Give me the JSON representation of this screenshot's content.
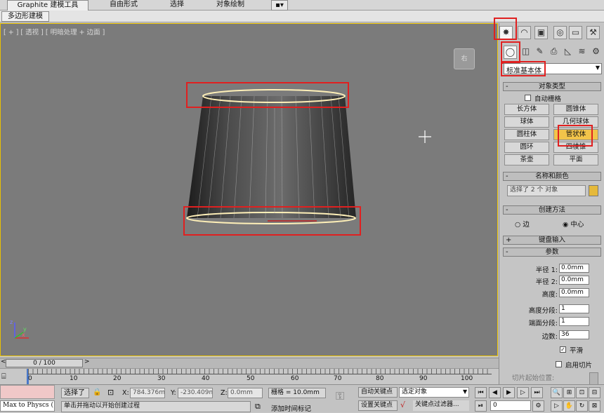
{
  "ribbon": {
    "tabs": [
      "Graphite 建模工具",
      "自由形式",
      "选择",
      "对象绘制",
      "▪▾"
    ],
    "subtab": "多边形建模"
  },
  "viewport": {
    "label": "[ + ] [ 透视 ] [ 明暗处理 + 边面 ]",
    "viewcube_label": "右",
    "axis_labels": [
      "z",
      "x",
      "y"
    ]
  },
  "panel": {
    "tab_icons": [
      "create-icon",
      "modify-icon",
      "hierarchy-icon",
      "motion-icon",
      "display-icon",
      "utilities-icon"
    ],
    "category_icons": [
      "geometry-icon",
      "shapes-icon",
      "lights-icon",
      "cameras-icon",
      "helpers-icon",
      "spacewarps-icon",
      "systems-icon"
    ],
    "dropdown": "标准基本体",
    "object_type": {
      "title": "对象类型",
      "autogrid": "自动栅格",
      "buttons": [
        "长方体",
        "圆锥体",
        "球体",
        "几何球体",
        "圆柱体",
        "管状体",
        "圆环",
        "四棱锥",
        "茶壶",
        "平面"
      ],
      "active": "管状体"
    },
    "name_color": {
      "title": "名称和颜色",
      "name_value": "选择了 2 个 对象",
      "swatch": "#e5b93a"
    },
    "creation_method": {
      "title": "创建方法",
      "options": [
        "边",
        "中心"
      ],
      "selected": "中心"
    },
    "keyboard_title": "键盘输入",
    "params": {
      "title": "参数",
      "radius1_label": "半径 1:",
      "radius1": "0.0mm",
      "radius2_label": "半径 2:",
      "radius2": "0.0mm",
      "height_label": "高度:",
      "height": "0.0mm",
      "height_segs_label": "高度分段:",
      "height_segs": "1",
      "cap_segs_label": "端面分段:",
      "cap_segs": "1",
      "sides_label": "边数:",
      "sides": "36",
      "smooth_label": "平滑",
      "slice_on_label": "启用切片",
      "slice_from_label": "切片起始位置:"
    }
  },
  "timeline": {
    "frame": "0 / 100",
    "ticks": [
      "0",
      "10",
      "20",
      "30",
      "40",
      "50",
      "60",
      "70",
      "80",
      "90",
      "100"
    ]
  },
  "status": {
    "maxscript": "Max to Physcs (",
    "selection": "选择了",
    "x_label": "X:",
    "x_value": "784.376mm",
    "y_label": "Y:",
    "y_value": "-230.409m",
    "z_label": "Z:",
    "z_value": "0.0mm",
    "grid": "栅格 = 10.0mm",
    "autokey": "自动关键点",
    "selected_dropdown": "选定对象",
    "setkey": "设置关键点",
    "key_filters": "关键点过滤器...",
    "prompt": "单击并拖动以开始创建过程",
    "add_time_tag": "添加时间标记",
    "frame_field": "0"
  },
  "colors": {
    "highlight": "#e02020",
    "active_button": "#f2c44a",
    "viewport_border": "#e8c000"
  }
}
